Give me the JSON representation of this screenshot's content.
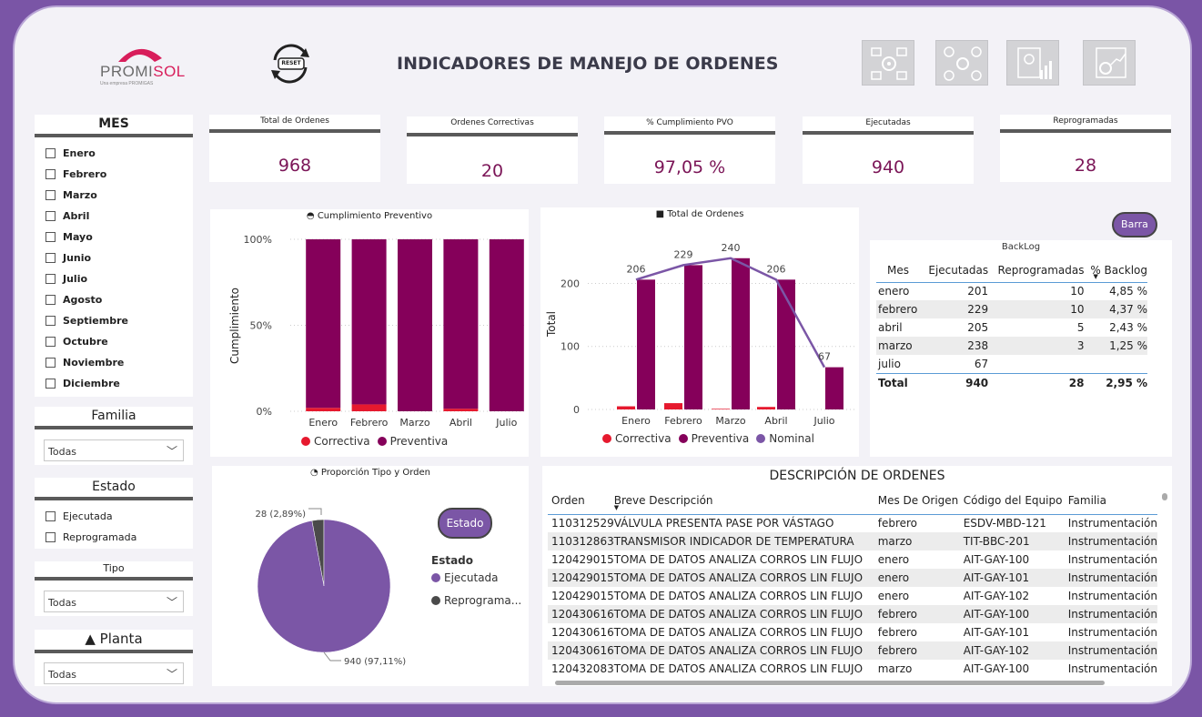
{
  "header": {
    "logo_text_a": "PROMI",
    "logo_text_b": "SOL",
    "logo_sub": "Una empresa PROMIGAS",
    "reset_label": "RESET",
    "title": "INDICADORES DE MANEJO DE ORDENES",
    "nav_icons": [
      "process-gears-icon",
      "network-gears-icon",
      "report-chart-icon",
      "settings-chart-icon"
    ]
  },
  "slicers": {
    "mes": {
      "title": "MES",
      "items": [
        "Enero",
        "Febrero",
        "Marzo",
        "Abril",
        "Mayo",
        "Junio",
        "Julio",
        "Agosto",
        "Septiembre",
        "Octubre",
        "Noviembre",
        "Diciembre"
      ]
    },
    "familia": {
      "title": "Familia",
      "value": "Todas"
    },
    "estado": {
      "title": "Estado",
      "items": [
        "Ejecutada",
        "Reprogramada"
      ]
    },
    "tipo": {
      "title": "Tipo",
      "value": "Todas"
    },
    "planta": {
      "title": "▲ Planta",
      "value": "Todas"
    }
  },
  "kpis": [
    {
      "label": "Total de Ordenes",
      "value": "968"
    },
    {
      "label": "Ordenes Correctivas",
      "value": "20"
    },
    {
      "label": "% Cumplimiento PVO",
      "value": "97,05 %"
    },
    {
      "label": "Ejecutadas",
      "value": "940"
    },
    {
      "label": "Reprogramadas",
      "value": "28"
    }
  ],
  "colors": {
    "preventiva": "#85005a",
    "correctiva": "#e6192e",
    "nominal": "#7b56a6",
    "kpi_value": "#7b1557",
    "pie_main": "#7b56a6",
    "pie_minor": "#4a4a4a"
  },
  "chart_data": [
    {
      "type": "bar",
      "title": "Cumplimiento Preventivo",
      "ylabel": "Cumplimiento",
      "categories": [
        "Enero",
        "Febrero",
        "Marzo",
        "Abril",
        "Julio"
      ],
      "yticks": [
        "0%",
        "50%",
        "100%"
      ],
      "ylim": [
        0,
        1
      ],
      "stacked": true,
      "series": [
        {
          "name": "Correctiva",
          "values": [
            0.02,
            0.04,
            0.0,
            0.015,
            0.0
          ]
        },
        {
          "name": "Preventiva",
          "values": [
            0.98,
            0.96,
            1.0,
            0.985,
            1.0
          ]
        }
      ],
      "legend": "bottom"
    },
    {
      "type": "bar",
      "title": "Total de Ordenes",
      "ylabel": "Total",
      "categories": [
        "Enero",
        "Febrero",
        "Marzo",
        "Abril",
        "Julio"
      ],
      "yticks": [
        "0",
        "100",
        "200"
      ],
      "ylim": [
        0,
        250
      ],
      "series": [
        {
          "name": "Correctiva",
          "values": [
            5,
            10,
            1,
            4,
            0
          ]
        },
        {
          "name": "Preventiva",
          "values": [
            206,
            229,
            240,
            206,
            67
          ]
        },
        {
          "name": "Nominal",
          "type": "line",
          "values": [
            206,
            229,
            240,
            206,
            67
          ]
        }
      ],
      "data_labels": [
        "206",
        "229",
        "240",
        "206",
        "67"
      ],
      "legend": "bottom"
    },
    {
      "type": "pie",
      "title": "Proporción Tipo y Orden",
      "legend_title": "Estado",
      "slices": [
        {
          "name": "Ejecutada",
          "value": 940,
          "label": "940 (97,11%)"
        },
        {
          "name": "Reprograma...",
          "value": 28,
          "label": "28 (2,89%)"
        }
      ],
      "legend": "right"
    }
  ],
  "buttons": {
    "barra": "Barra",
    "estado": "Estado"
  },
  "backlog": {
    "title": "BackLog",
    "columns": [
      "Mes",
      "Ejecutadas",
      "Reprogramadas",
      "% Backlog"
    ],
    "rows": [
      [
        "enero",
        "201",
        "10",
        "4,85 %"
      ],
      [
        "febrero",
        "229",
        "10",
        "4,37 %"
      ],
      [
        "abril",
        "205",
        "5",
        "2,43 %"
      ],
      [
        "marzo",
        "238",
        "3",
        "1,25 %"
      ],
      [
        "julio",
        "67",
        "",
        ""
      ]
    ],
    "total": [
      "Total",
      "940",
      "28",
      "2,95 %"
    ]
  },
  "orders": {
    "title": "DESCRIPCIÓN DE ORDENES",
    "columns": [
      "Orden",
      "Breve Descripción",
      "Mes De Origen",
      "Código del Equipo",
      "Familia"
    ],
    "rows": [
      [
        "110312529",
        "VÁLVULA PRESENTA PASE POR VÁSTAGO",
        "febrero",
        "ESDV-MBD-121",
        "Instrumentación"
      ],
      [
        "110312863",
        "TRANSMISOR INDICADOR DE TEMPERATURA",
        "marzo",
        "TIT-BBC-201",
        "Instrumentación"
      ],
      [
        "120429015",
        "TOMA DE DATOS ANALIZA CORROS LIN FLUJO",
        "enero",
        "AIT-GAY-100",
        "Instrumentación"
      ],
      [
        "120429015",
        "TOMA DE DATOS ANALIZA CORROS LIN FLUJO",
        "enero",
        "AIT-GAY-101",
        "Instrumentación"
      ],
      [
        "120429015",
        "TOMA DE DATOS ANALIZA CORROS LIN FLUJO",
        "enero",
        "AIT-GAY-102",
        "Instrumentación"
      ],
      [
        "120430616",
        "TOMA DE DATOS ANALIZA CORROS LIN FLUJO",
        "febrero",
        "AIT-GAY-100",
        "Instrumentación"
      ],
      [
        "120430616",
        "TOMA DE DATOS ANALIZA CORROS LIN FLUJO",
        "febrero",
        "AIT-GAY-101",
        "Instrumentación"
      ],
      [
        "120430616",
        "TOMA DE DATOS ANALIZA CORROS LIN FLUJO",
        "febrero",
        "AIT-GAY-102",
        "Instrumentación"
      ],
      [
        "120432083",
        "TOMA DE DATOS ANALIZA CORROS LIN FLUJO",
        "marzo",
        "AIT-GAY-100",
        "Instrumentación"
      ]
    ]
  }
}
